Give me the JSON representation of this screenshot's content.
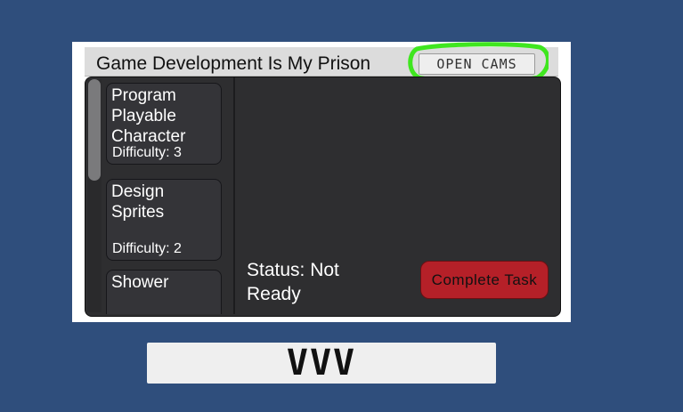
{
  "window": {
    "title": "Game Development Is My Prison",
    "open_cams_label": "OPEN CAMS"
  },
  "tasks": [
    {
      "name": "Program Playable Character",
      "difficulty": "Difficulty: 3"
    },
    {
      "name": "Design Sprites",
      "difficulty": "Difficulty: 2"
    },
    {
      "name": "Shower",
      "difficulty": ""
    }
  ],
  "detail": {
    "status": "Status: Not Ready",
    "complete_label": "Complete Task"
  },
  "bottom_bar": {
    "text": "VVV"
  },
  "colors": {
    "background": "#2f4e7c",
    "highlight": "#3fe61f",
    "complete_button": "#b52028",
    "panel": "#2e2e30"
  }
}
